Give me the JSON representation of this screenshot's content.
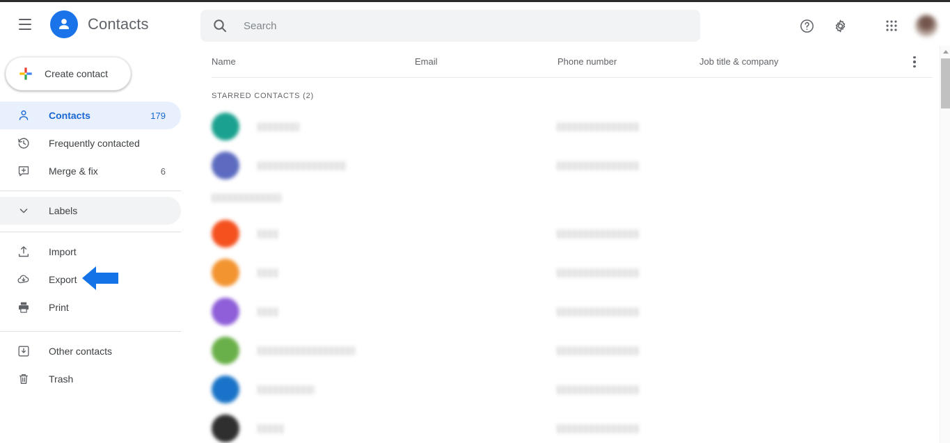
{
  "app": {
    "title": "Contacts",
    "logo_icon": "person-circle-icon",
    "menu_icon": "hamburger-menu-icon"
  },
  "search": {
    "placeholder": "Search",
    "value": "",
    "icon": "search-icon"
  },
  "header_actions": [
    {
      "name": "help-icon",
      "label": "Help"
    },
    {
      "name": "gear-icon",
      "label": "Settings"
    },
    {
      "name": "apps-grid-icon",
      "label": "Google apps"
    },
    {
      "name": "avatar",
      "label": "Account"
    }
  ],
  "sidebar": {
    "create_button": {
      "label": "Create contact",
      "icon": "plus-icon"
    },
    "primary_items": [
      {
        "label": "Contacts",
        "count": "179",
        "icon": "person-icon",
        "active": true
      },
      {
        "label": "Frequently contacted",
        "count": "",
        "icon": "history-icon",
        "active": false
      },
      {
        "label": "Merge & fix",
        "count": "6",
        "icon": "merge-icon",
        "active": false
      }
    ],
    "labels_section": {
      "label": "Labels",
      "icon": "chevron-down-icon"
    },
    "tools_items": [
      {
        "label": "Import",
        "icon": "upload-icon"
      },
      {
        "label": "Export",
        "icon": "cloud-download-icon"
      },
      {
        "label": "Print",
        "icon": "printer-icon"
      }
    ],
    "footer_items": [
      {
        "label": "Other contacts",
        "icon": "box-down-icon"
      },
      {
        "label": "Trash",
        "icon": "trash-icon"
      }
    ]
  },
  "annotation": {
    "name": "pointer-arrow",
    "points_at": "Export",
    "color": "#1473e6",
    "direction": "left"
  },
  "table": {
    "columns": [
      "Name",
      "Email",
      "Phone number",
      "Job title & company"
    ],
    "overflow_icon": "more-vert-icon",
    "section_label": "STARRED CONTACTS (2)",
    "rows": [
      {
        "avatar_color": "#1aa18f",
        "name_redacted_width": 60,
        "phone_redacted": true
      },
      {
        "avatar_color": "#5c6bc0",
        "name_redacted_width": 128,
        "phone_redacted": true
      },
      {
        "avatar_color": "",
        "name_redacted_width": 100,
        "phone_redacted": false,
        "no_avatar": true
      },
      {
        "avatar_color": "#f4511e",
        "name_redacted_width": 30,
        "phone_redacted": true
      },
      {
        "avatar_color": "#f29430",
        "name_redacted_width": 30,
        "phone_redacted": true
      },
      {
        "avatar_color": "#8e5fd9",
        "name_redacted_width": 30,
        "phone_redacted": true
      },
      {
        "avatar_color": "#6ab04a",
        "name_redacted_width": 140,
        "phone_redacted": true
      },
      {
        "avatar_color": "#1a73c8",
        "name_redacted_width": 82,
        "phone_redacted": true
      },
      {
        "avatar_color": "#2f2f2f",
        "name_redacted_width": 38,
        "phone_redacted": true
      }
    ]
  },
  "scrollbar": {
    "up_arrow": "scroll-up-arrow",
    "thumb": "scroll-thumb"
  },
  "colors": {
    "accent": "#1a73e8",
    "active_pill": "#e8f0fe",
    "active_text": "#1967d2",
    "text": "#3c4043",
    "muted": "#5f6368",
    "search_bg": "#f1f3f4"
  }
}
